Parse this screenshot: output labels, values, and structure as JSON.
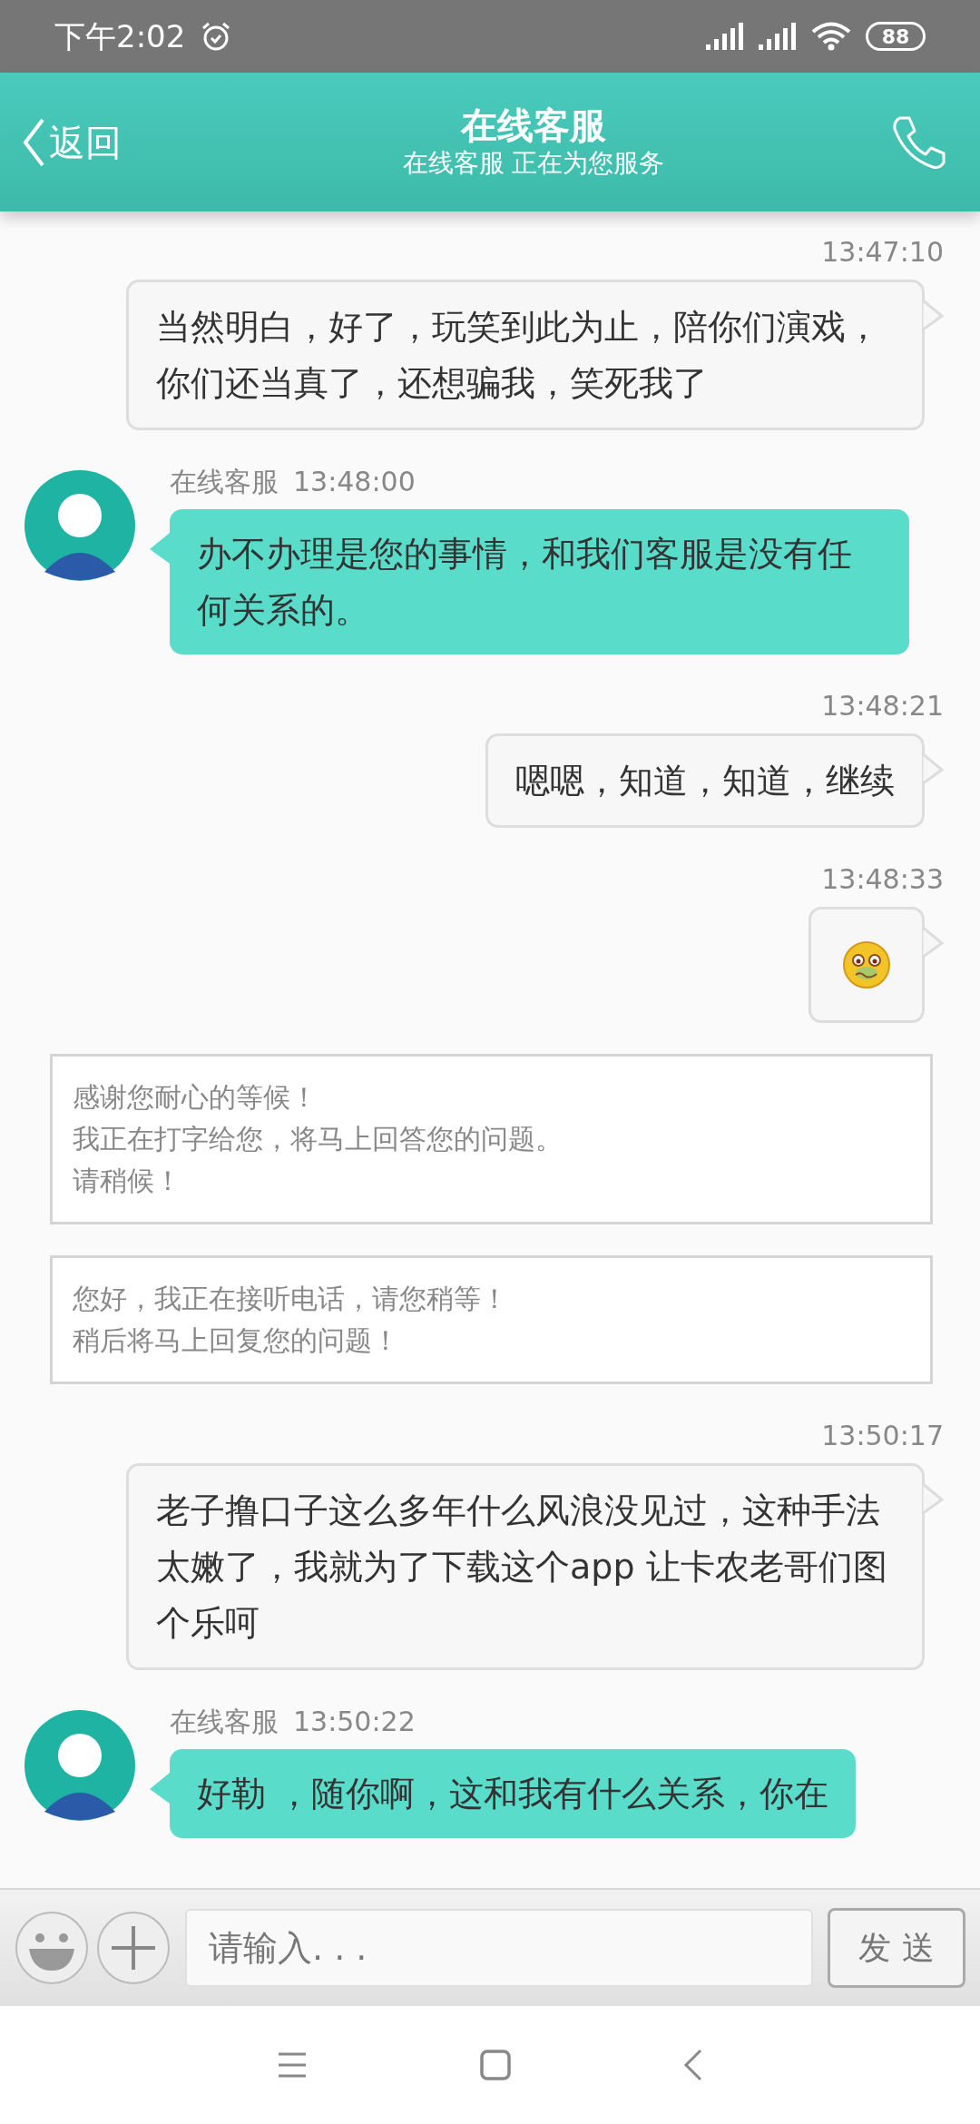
{
  "status_bar": {
    "time": "下午2:02",
    "battery": "88"
  },
  "header": {
    "back_label": "返回",
    "title": "在线客服",
    "subtitle": "在线客服 正在为您服务"
  },
  "messages": [
    {
      "kind": "outgoing",
      "time": "13:47:10",
      "text": "当然明白，好了，玩笑到此为止，陪你们演戏，你们还当真了，还想骗我，笑死我了"
    },
    {
      "kind": "incoming",
      "sender": "在线客服",
      "time": "13:48:00",
      "text": "办不办理是您的事情，和我们客服是没有任何关系的。"
    },
    {
      "kind": "outgoing",
      "time": "13:48:21",
      "text": "嗯嗯，知道，知道，继续"
    },
    {
      "kind": "sticker",
      "time": "13:48:33"
    },
    {
      "kind": "notice",
      "lines": [
        "感谢您耐心的等候！",
        "我正在打字给您，将马上回答您的问题。",
        "请稍候！"
      ]
    },
    {
      "kind": "notice",
      "lines": [
        "您好，我正在接听电话，请您稍等！",
        "稍后将马上回复您的问题！"
      ]
    },
    {
      "kind": "outgoing",
      "time": "13:50:17",
      "text": "老子撸口子这么多年什么风浪没见过，这种手法太嫩了，我就为了下载这个app 让卡农老哥们图个乐呵"
    },
    {
      "kind": "incoming",
      "sender": "在线客服",
      "time": "13:50:22",
      "text": "好勒 ，随你啊，这和我有什么关系，你在"
    }
  ],
  "composer": {
    "placeholder": "请输入. . .",
    "send_label": "发 送"
  }
}
